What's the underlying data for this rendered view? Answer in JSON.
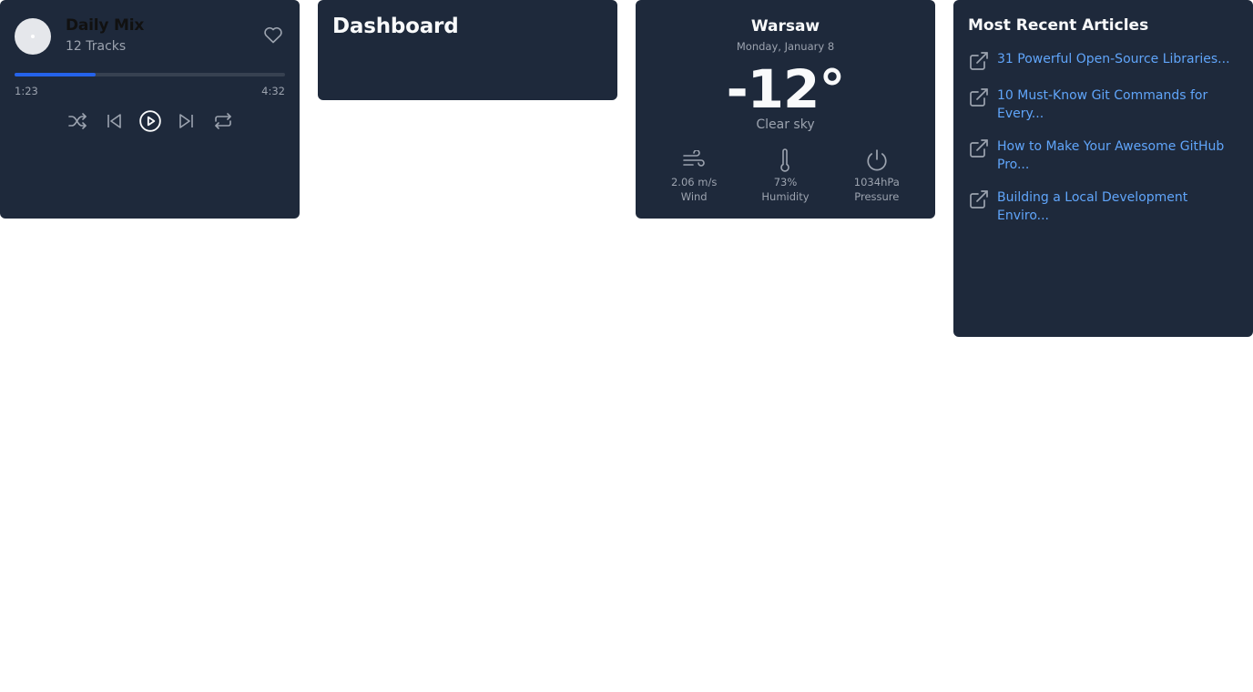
{
  "player": {
    "title": "Daily Mix",
    "subtitle": "12 Tracks",
    "progress": 0.3,
    "current_time": "1:23",
    "total_time": "4:32",
    "icons": [
      "heart-icon",
      "shuffle-icon",
      "previous-icon",
      "play-icon",
      "next-icon",
      "repeat-icon"
    ],
    "accent_color": "#2563eb"
  },
  "dashboard": {
    "title": "Dashboard"
  },
  "weather": {
    "city": "Warsaw",
    "date": "Monday, January 8",
    "temperature": "-12°",
    "description": "Clear sky",
    "stats": [
      {
        "icon": "wind-icon",
        "value": "2.06 m/s",
        "label": "Wind"
      },
      {
        "icon": "thermometer-icon",
        "value": "73%",
        "label": "Humidity"
      },
      {
        "icon": "power-icon",
        "value": "1034hPa",
        "label": "Pressure"
      }
    ]
  },
  "articles": {
    "title": "Most Recent Articles",
    "items": [
      {
        "lines": [
          "31 Powerful Open-Source Libraries..."
        ]
      },
      {
        "lines": [
          "10 Must-Know Git Commands for",
          "Every..."
        ]
      },
      {
        "lines": [
          "How to Make Your Awesome GitHub",
          "Pro..."
        ]
      },
      {
        "lines": [
          "Building a Local Development Enviro..."
        ]
      }
    ],
    "link_color": "#60a5fa"
  }
}
